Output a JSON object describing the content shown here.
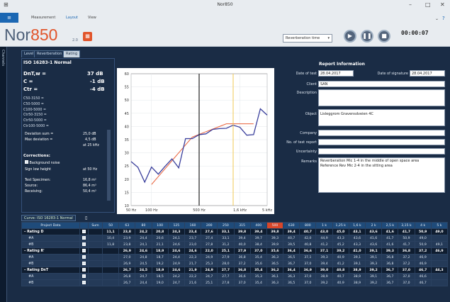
{
  "window": {
    "title": "Nor850"
  },
  "menu": {
    "file": "≡",
    "items": [
      "Measurement",
      "Layout",
      "View"
    ]
  },
  "header": {
    "logo": "Nor850",
    "logo_ver": "2.0",
    "mode_select": "Reverberation time",
    "timer": "00:00:07",
    "side_tab": "Channels"
  },
  "tabs": [
    "Level",
    "Reverberation",
    "Rating"
  ],
  "rating": {
    "standard": "ISO 16283-1 Normal",
    "dntw_label": "DnT,w =",
    "dntw": "37 dB",
    "c_label": "C =",
    "c": "-1 dB",
    "ctr_label": "Ctr =",
    "ctr": "-4 dB",
    "spectrum_terms": [
      "C50-3150 =",
      "C50-5000 =",
      "C100-5000 =",
      "Ctr50-3150 =",
      "Ctr50-5000 =",
      "Ctr100-5000 ="
    ],
    "dev_sum_label": "Deviation sum =",
    "dev_sum": "25,0 dB",
    "max_dev_label": "Max deviation =",
    "max_dev": "4,5 dB",
    "max_dev_at": "at 25 kHz",
    "corrections_title": "Corrections:",
    "bg_noise": "Background noise",
    "sign_label": "Sign low height",
    "sign_val": "at 50 Hz",
    "test_spec_label": "Test Specimen:",
    "test_spec": "16,8 m²",
    "source_label": "Source:",
    "source": "86,4 m³",
    "receiving_label": "Receiving:",
    "receiving": "50,4 m³"
  },
  "report": {
    "title": "Report Information",
    "date_of_test_label": "Date of test",
    "date_of_test": "28.04.2017",
    "date_of_sig_label": "Date of signature",
    "date_of_sig": "28.04.2017",
    "client_label": "Client",
    "client": "SAN",
    "description_label": "Description",
    "description": "",
    "object_label": "Object",
    "object": "Lisleggrom Gravensdveien 4C",
    "company_label": "Company",
    "company": "",
    "report_no_label": "No. of test report",
    "report_no": "",
    "uncertainty_label": "Uncertainty",
    "uncertainty": "",
    "remarks_label": "Remarks",
    "remarks": [
      "Reverberation Mic 1-4 in the middle of open space area",
      "Reference Rev Mic 2-4 in the sitting area"
    ]
  },
  "curve_tab": "Curve: ISO 16283-1 Normal",
  "chart_data": {
    "type": "line",
    "ylim": [
      10,
      60
    ],
    "yticks": [
      60,
      55,
      50,
      45,
      40,
      35,
      30,
      25,
      20,
      15,
      10
    ],
    "xticks": [
      "50 Hz",
      "100 Hz",
      "500 Hz",
      "1,6 kHz",
      "5 kHz"
    ],
    "freqs": [
      "50",
      "63",
      "80",
      "100",
      "125",
      "160",
      "200",
      "250",
      "315",
      "400",
      "500",
      "630",
      "800",
      "1k",
      "1,25k",
      "1,6k",
      "2k",
      "2,5k",
      "3,15k",
      "4k",
      "5k"
    ],
    "series": [
      {
        "values": [
          26.7,
          24.5,
          18.9,
          24.6,
          21.9,
          24.9,
          27.7,
          24.3,
          35.4,
          35.4,
          36.9,
          37.2,
          38.9,
          39.2,
          39.3,
          40.5,
          39.7,
          36.7,
          36.9,
          46.7,
          44.3
        ],
        "color": "#3a3f9c"
      },
      {
        "values": [
          null,
          null,
          null,
          null,
          null,
          null,
          null,
          null,
          null,
          null,
          null,
          null,
          null,
          null,
          null,
          null,
          null,
          null,
          null,
          null,
          null
        ],
        "color": "#e8613a"
      }
    ],
    "ref_values": [
      null,
      null,
      null,
      18.0,
      21.0,
      24.0,
      27.0,
      30.0,
      33.0,
      36.0,
      37.0,
      38.0,
      39.0,
      40.0,
      41.0,
      41.0,
      41.0,
      41.0,
      41.0,
      null,
      null
    ],
    "marker_freq_index": 10
  },
  "table": {
    "head": [
      "Project Data",
      "",
      "Sum",
      "50",
      "63",
      "80",
      "100",
      "125",
      "160",
      "200",
      "250",
      "315",
      "400",
      "500",
      "630",
      "800",
      "1 k",
      "1,25 k",
      "1,6 k",
      "2 k",
      "2,5 k",
      "3,15 k",
      "4 k",
      "5 k"
    ],
    "rows": [
      {
        "kind": "main",
        "label": "Rating D",
        "vals": [
          "",
          "11,1",
          "23,8",
          "24,2",
          "20,8",
          "24,3",
          "23,4",
          "27,6",
          "33,1",
          "39,8",
          "39,4",
          "39,8",
          "39,4",
          "40,7",
          "43,0",
          "45,0",
          "43,1",
          "43,6",
          "41,6",
          "41,7",
          "50,9",
          "49,0"
        ]
      },
      {
        "kind": "sub",
        "label": "#A",
        "vals": [
          "",
          "10,4",
          "23,9",
          "24,4",
          "20,6",
          "24,1",
          "23,7",
          "27,4",
          "33,1",
          "39,4",
          "39,7",
          "39,3",
          "40,7",
          "42,0",
          "44,9",
          "43,3",
          "43,6",
          "41,6",
          "41,7",
          "50,9",
          "49,0",
          ""
        ]
      },
      {
        "kind": "sub",
        "label": "#B",
        "vals": [
          "",
          "11,8",
          "23,8",
          "24,1",
          "21,1",
          "24,6",
          "23,0",
          "27,8",
          "31,2",
          "40,0",
          "38,4",
          "39,9",
          "39,5",
          "40,8",
          "41,2",
          "45,2",
          "43,3",
          "43,6",
          "41,6",
          "41,7",
          "50,9",
          "49,1"
        ]
      },
      {
        "kind": "main",
        "label": "Rating R'",
        "vals": [
          "",
          "",
          "26,9",
          "24,6",
          "18,9",
          "24,6",
          "24,6",
          "22,0",
          "25,1",
          "27,9",
          "37,0",
          "35,6",
          "36,4",
          "36,6",
          "37,1",
          "39,2",
          "41,0",
          "39,1",
          "39,3",
          "36,8",
          "37,2",
          "46,9"
        ]
      },
      {
        "kind": "sub",
        "label": "#A",
        "vals": [
          "",
          "",
          "27,0",
          "24,8",
          "18,7",
          "24,4",
          "22,3",
          "24,9",
          "27,9",
          "36,8",
          "35,4",
          "36,3",
          "36,5",
          "37,1",
          "39,3",
          "40,9",
          "39,1",
          "39,1",
          "36,8",
          "37,2",
          "46,9",
          ""
        ]
      },
      {
        "kind": "sub",
        "label": "#B",
        "vals": [
          "",
          "",
          "26,9",
          "24,5",
          "19,2",
          "24,9",
          "21,7",
          "25,3",
          "28,0",
          "37,2",
          "35,6",
          "36,5",
          "36,7",
          "37,0",
          "39,4",
          "41,2",
          "39,1",
          "39,3",
          "36,8",
          "37,2",
          "46,9",
          ""
        ]
      },
      {
        "kind": "main",
        "label": "Rating DnT",
        "vals": [
          "",
          "",
          "26,7",
          "24,5",
          "18,9",
          "24,6",
          "21,9",
          "24,9",
          "27,7",
          "36,8",
          "35,4",
          "36,2",
          "36,4",
          "36,9",
          "39,0",
          "40,8",
          "38,9",
          "39,2",
          "36,7",
          "37,0",
          "46,7",
          "44,3"
        ]
      },
      {
        "kind": "sub",
        "label": "#A",
        "vals": [
          "",
          "",
          "26,8",
          "24,7",
          "18,5",
          "24,2",
          "22,2",
          "24,7",
          "27,7",
          "36,6",
          "35,3",
          "36,1",
          "36,3",
          "37,0",
          "38,9",
          "40,7",
          "38,9",
          "39,1",
          "36,7",
          "37,0",
          "46,6",
          ""
        ]
      },
      {
        "kind": "sub",
        "label": "#B",
        "vals": [
          "",
          "",
          "26,7",
          "24,4",
          "19,0",
          "24,7",
          "21,6",
          "25,1",
          "27,8",
          "37,0",
          "35,4",
          "36,3",
          "36,5",
          "37,0",
          "39,2",
          "40,9",
          "38,9",
          "39,2",
          "36,7",
          "37,0",
          "46,7",
          ""
        ]
      }
    ]
  }
}
